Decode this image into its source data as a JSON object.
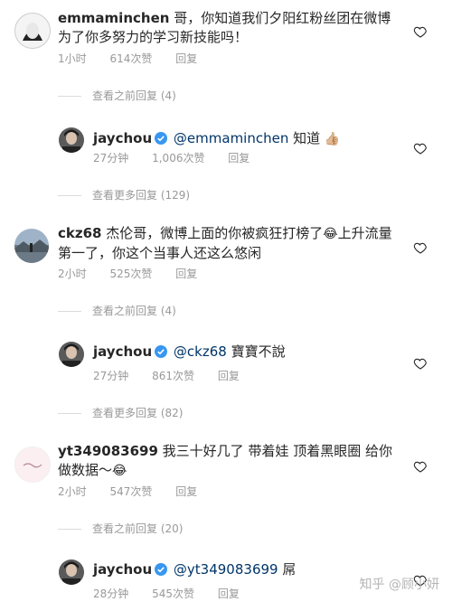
{
  "comments": [
    {
      "username": "emmaminchen",
      "text": "哥，你知道我们夕阳红粉丝团在微博为了你多努力的学习新技能吗！",
      "time": "1小时",
      "likes": "614次赞",
      "reply": "回复",
      "view_replies": "查看之前回复 (4)",
      "replies": [
        {
          "username": "jaychou",
          "mention": "@emmaminchen",
          "text": " 知道 ",
          "emoji": "👍🏼",
          "time": "27分钟",
          "likes": "1,006次赞",
          "reply": "回复"
        }
      ],
      "view_more": "查看更多回复 (129)"
    },
    {
      "username": "ckz68",
      "text": "杰伦哥，微博上面的你被疯狂打榜了",
      "emoji": "😂",
      "text2": "上升流量第一了，你这个当事人还这么悠闲",
      "time": "2小时",
      "likes": "525次赞",
      "reply": "回复",
      "view_replies": "查看之前回复 (4)",
      "replies": [
        {
          "username": "jaychou",
          "mention": "@ckz68",
          "text": " 寶寶不說",
          "time": "27分钟",
          "likes": "861次赞",
          "reply": "回复"
        }
      ],
      "view_more": "查看更多回复 (82)"
    },
    {
      "username": "yt349083699",
      "text": "我三十好几了 带着娃 顶着黑眼圈 给你做数据～",
      "emoji": "😂",
      "time": "2小时",
      "likes": "547次赞",
      "reply": "回复",
      "view_replies": "查看之前回复 (20)",
      "replies": [
        {
          "username": "jaychou",
          "mention": "@yt349083699",
          "text": " 屌",
          "time": "28分钟",
          "likes": "545次赞",
          "reply": "回复"
        }
      ]
    }
  ],
  "watermark": "知乎 @顾小妍",
  "colors": {
    "mention": "#003569",
    "meta": "#999999",
    "verified": "#3897f0"
  }
}
